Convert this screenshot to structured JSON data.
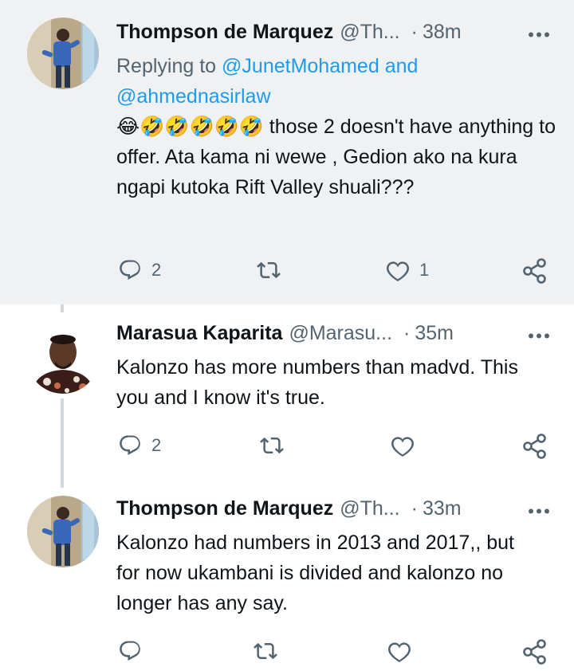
{
  "tweets": [
    {
      "name": "Thompson de Marquez",
      "handle": "@Th...",
      "time": "38m",
      "replying_prefix": "Replying to ",
      "mention1": "@JunetMohamed",
      "and_text": " and",
      "mention2": "@ahmednasirlaw",
      "emojis": "😂🤣🤣🤣🤣🤣",
      "text": " those 2 doesn't have anything to offer. Ata kama ni wewe , Gedion ako na kura ngapi kutoka Rift Valley shuali???",
      "replies": "2",
      "likes": "1"
    },
    {
      "name": "Marasua Kaparita",
      "handle": "@Marasu...",
      "time": "35m",
      "text": "Kalonzo has more numbers than madvd. This you and I know it's true.",
      "replies": "2"
    },
    {
      "name": "Thompson de Marquez",
      "handle": "@Th...",
      "time": "33m",
      "text": "Kalonzo had numbers in 2013 and 2017,, but for now ukambani is divided and kalonzo no longer has any say."
    }
  ],
  "icons": {
    "reply": "reply-icon",
    "retweet": "retweet-icon",
    "like": "heart-icon",
    "share": "share-icon",
    "more": "more-icon"
  },
  "colors": {
    "text": "#0f1419",
    "muted": "#536471",
    "link": "#1d9bf0",
    "highlight_bg": "#eff1f3",
    "thread_line": "#cfd9de"
  }
}
